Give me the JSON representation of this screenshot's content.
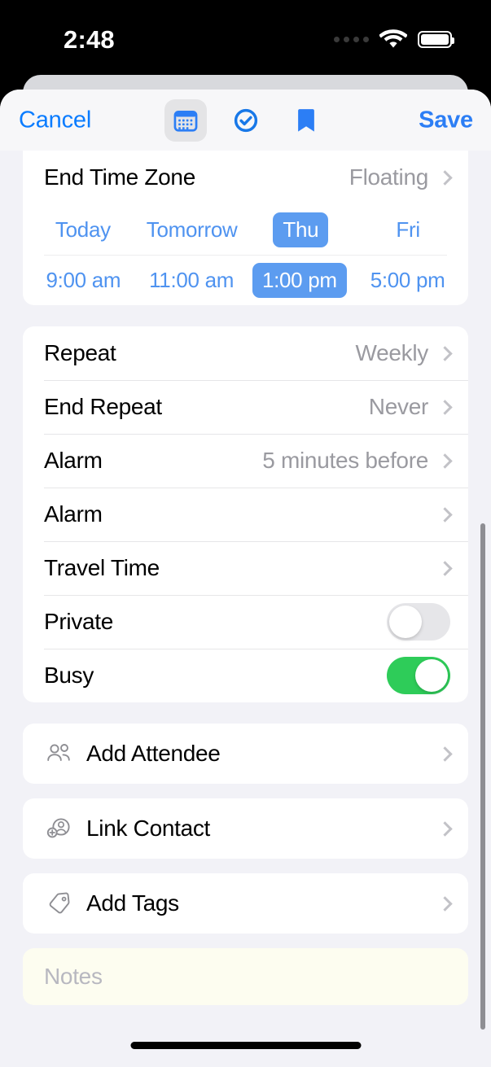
{
  "status_bar": {
    "time": "2:48",
    "cellular_icon": "cellular-dots-icon",
    "wifi_icon": "wifi-icon",
    "battery_icon": "battery-full-icon"
  },
  "toolbar": {
    "cancel_label": "Cancel",
    "save_label": "Save",
    "icons": [
      {
        "name": "calendar-icon",
        "selected": true
      },
      {
        "name": "checkmark-circle-icon",
        "selected": false
      },
      {
        "name": "bookmark-icon",
        "selected": false
      }
    ],
    "accent_color": "#0a7cff"
  },
  "sections": {
    "time_zone": {
      "row": {
        "label": "End Time Zone",
        "value": "Floating"
      },
      "date_options": [
        {
          "label": "Today",
          "selected": false
        },
        {
          "label": "Tomorrow",
          "selected": false
        },
        {
          "label": "Thu",
          "selected": true
        },
        {
          "label": "Fri",
          "selected": false
        }
      ],
      "time_options": [
        {
          "label": "9:00 am",
          "selected": false
        },
        {
          "label": "11:00 am",
          "selected": false
        },
        {
          "label": "1:00 pm",
          "selected": true
        },
        {
          "label": "5:00 pm",
          "selected": false
        }
      ]
    },
    "options": [
      {
        "label": "Repeat",
        "value": "Weekly",
        "type": "disclosure"
      },
      {
        "label": "End Repeat",
        "value": "Never",
        "type": "disclosure"
      },
      {
        "label": "Alarm",
        "value": "5 minutes before",
        "type": "disclosure"
      },
      {
        "label": "Alarm",
        "value": "",
        "type": "disclosure"
      },
      {
        "label": "Travel Time",
        "value": "",
        "type": "disclosure"
      },
      {
        "label": "Private",
        "value": "",
        "type": "toggle",
        "on": false
      },
      {
        "label": "Busy",
        "value": "",
        "type": "toggle",
        "on": true
      }
    ],
    "actions": [
      {
        "label": "Add Attendee",
        "icon": "people-icon"
      },
      {
        "label": "Link Contact",
        "icon": "contact-badge-plus-icon"
      },
      {
        "label": "Add Tags",
        "icon": "tag-icon"
      }
    ],
    "notes": {
      "placeholder": "Notes"
    }
  },
  "colors": {
    "accent_blue": "#0a7cff",
    "chip_blue": "#5c9cf0",
    "toggle_green": "#2ecc59",
    "notes_bg": "#fdfdf0",
    "page_bg": "#f2f2f7"
  }
}
